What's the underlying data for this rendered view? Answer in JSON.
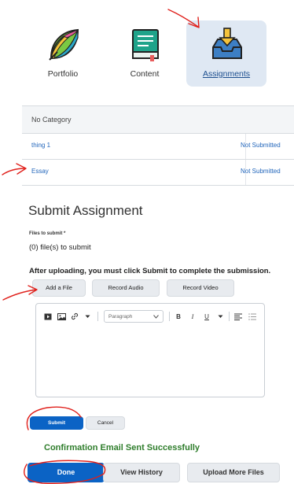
{
  "nav": {
    "items": [
      {
        "label": "Portfolio",
        "icon": "leaf-icon",
        "active": false
      },
      {
        "label": "Content",
        "icon": "book-icon",
        "active": false
      },
      {
        "label": "Assignments",
        "icon": "inbox-download-icon",
        "active": true
      }
    ]
  },
  "table": {
    "header": "No Category",
    "rows": [
      {
        "name": "thing 1",
        "status": "Not Submitted"
      },
      {
        "name": "Essay",
        "status": "Not Submitted"
      }
    ]
  },
  "submit": {
    "heading": "Submit Assignment",
    "files_label": "Files to submit *",
    "files_count": "(0) file(s) to submit",
    "instruction": "After uploading, you must click Submit to complete the submission.",
    "add_file": "Add a File",
    "record_audio": "Record Audio",
    "record_video": "Record Video",
    "editor": {
      "paragraph": "Paragraph",
      "bold": "B",
      "italic": "I",
      "underline": "U"
    },
    "submit_label": "Submit",
    "cancel_label": "Cancel"
  },
  "confirmation": {
    "message": "Confirmation Email Sent Successfully",
    "done": "Done",
    "view_history": "View History",
    "upload_more": "Upload More Files"
  },
  "colors": {
    "primary": "#0b63c5",
    "link": "#2266bb",
    "success": "#2e7d2b",
    "annotation": "#e0201b",
    "active_tab_bg": "#dfe8f3"
  }
}
